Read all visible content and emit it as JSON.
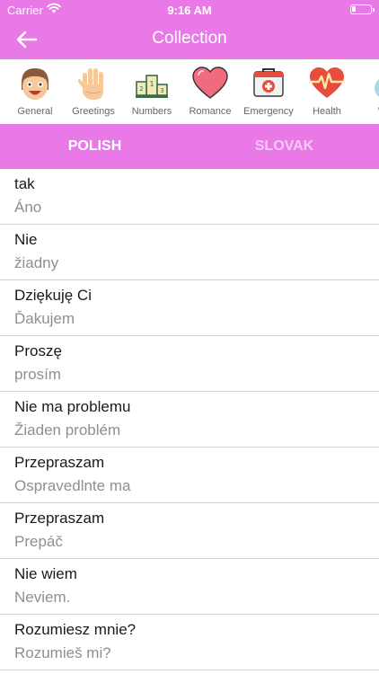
{
  "status": {
    "carrier": "Carrier",
    "time": "9:16 AM"
  },
  "nav": {
    "title": "Collection"
  },
  "categories": [
    {
      "label": "General",
      "icon": "face-icon"
    },
    {
      "label": "Greetings",
      "icon": "hand-icon"
    },
    {
      "label": "Numbers",
      "icon": "podium-icon"
    },
    {
      "label": "Romance",
      "icon": "heart-icon"
    },
    {
      "label": "Emergency",
      "icon": "first-aid-icon"
    },
    {
      "label": "Health",
      "icon": "heartbeat-icon"
    },
    {
      "label": "We",
      "icon": "partial-icon"
    }
  ],
  "tabs": {
    "source": "POLISH",
    "target": "SLOVAK"
  },
  "phrases": [
    {
      "polish": "tak",
      "slovak": "Áno"
    },
    {
      "polish": "Nie",
      "slovak": "žiadny"
    },
    {
      "polish": "Dziękuję Ci",
      "slovak": "Ďakujem"
    },
    {
      "polish": "Proszę",
      "slovak": "prosím"
    },
    {
      "polish": "Nie ma problemu",
      "slovak": "Žiaden problém"
    },
    {
      "polish": "Przepraszam",
      "slovak": "Ospravedlnte ma"
    },
    {
      "polish": "Przepraszam",
      "slovak": "Prepáč"
    },
    {
      "polish": "Nie wiem",
      "slovak": "Neviem."
    },
    {
      "polish": "Rozumiesz mnie?",
      "slovak": "Rozumieš mi?"
    }
  ],
  "colors": {
    "accent": "#e879e6",
    "inactive_tab": "#f7c9f6",
    "secondary_text": "#8e8e93"
  }
}
